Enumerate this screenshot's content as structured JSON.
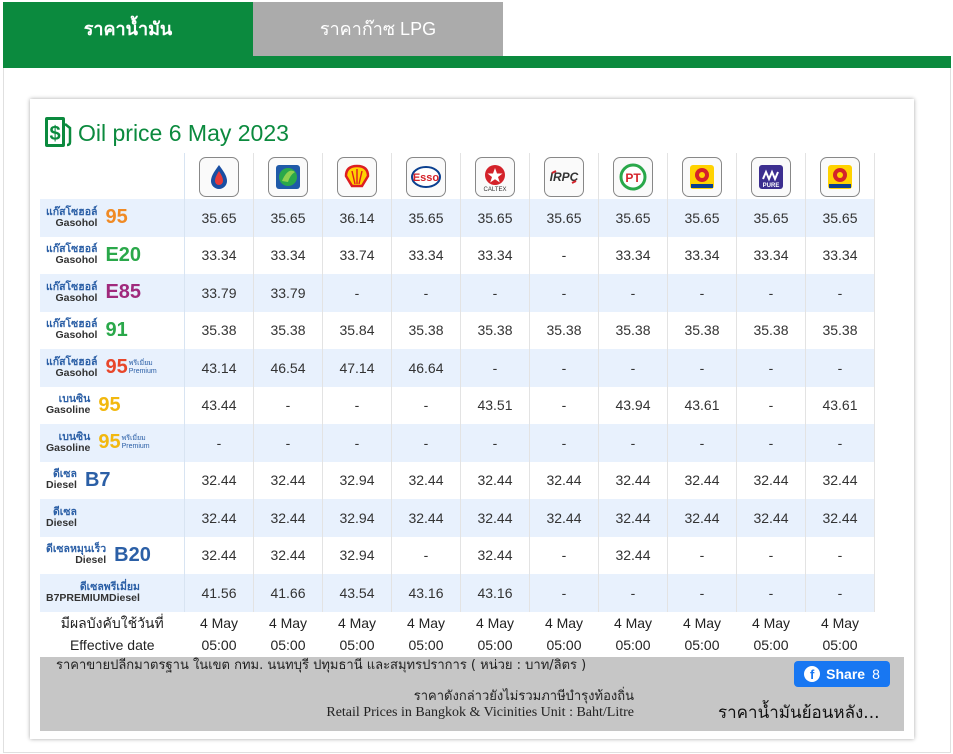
{
  "tabs": [
    {
      "label": "ราคาน้ำมัน",
      "active": true
    },
    {
      "label": "ราคาก๊าซ LPG",
      "active": false
    }
  ],
  "title": "Oil price 6 May 2023",
  "icons": {
    "title": "dollar-pump-icon"
  },
  "colors": {
    "brand_green": "#0b8a3e",
    "row_stripe": "#e8f1fd",
    "footer_bg": "#c6c6c6",
    "share_blue": "#1877f2"
  },
  "brands": [
    {
      "name": "PTT Station",
      "icon": "ptt-logo-icon"
    },
    {
      "name": "Bangchak",
      "icon": "bangchak-logo-icon"
    },
    {
      "name": "Shell",
      "icon": "shell-logo-icon"
    },
    {
      "name": "Esso",
      "icon": "esso-logo-icon"
    },
    {
      "name": "Caltex",
      "icon": "caltex-logo-icon"
    },
    {
      "name": "IRPC",
      "icon": "irpc-logo-icon"
    },
    {
      "name": "PT",
      "icon": "pt-logo-icon"
    },
    {
      "name": "Susco",
      "icon": "susco-logo-icon"
    },
    {
      "name": "Pure",
      "icon": "pure-logo-icon"
    },
    {
      "name": "Susco",
      "icon": "susco-logo-icon"
    }
  ],
  "rows": [
    {
      "th": "แก๊สโซฮอล์",
      "en": "Gasohol",
      "code": "95",
      "code_color": "#f08a24",
      "premium": "",
      "prices": [
        "35.65",
        "35.65",
        "36.14",
        "35.65",
        "35.65",
        "35.65",
        "35.65",
        "35.65",
        "35.65",
        "35.65"
      ]
    },
    {
      "th": "แก๊สโซฮอล์",
      "en": "Gasohol",
      "code": "E20",
      "code_color": "#2aa84a",
      "premium": "",
      "prices": [
        "33.34",
        "33.34",
        "33.74",
        "33.34",
        "33.34",
        "-",
        "33.34",
        "33.34",
        "33.34",
        "33.34"
      ]
    },
    {
      "th": "แก๊สโซฮอล์",
      "en": "Gasohol",
      "code": "E85",
      "code_color": "#a0297c",
      "premium": "",
      "prices": [
        "33.79",
        "33.79",
        "-",
        "-",
        "-",
        "-",
        "-",
        "-",
        "-",
        "-"
      ]
    },
    {
      "th": "แก๊สโซฮอล์",
      "en": "Gasohol",
      "code": "91",
      "code_color": "#2aa84a",
      "premium": "",
      "prices": [
        "35.38",
        "35.38",
        "35.84",
        "35.38",
        "35.38",
        "35.38",
        "35.38",
        "35.38",
        "35.38",
        "35.38"
      ]
    },
    {
      "th": "แก๊สโซฮอล์",
      "en": "Gasohol",
      "code": "95",
      "code_color": "#e8462a",
      "premium": "พรีเมี่ยม Premium",
      "prices": [
        "43.14",
        "46.54",
        "47.14",
        "46.64",
        "-",
        "-",
        "-",
        "-",
        "-",
        "-"
      ]
    },
    {
      "th": "เบนซิน",
      "en": "Gasoline",
      "code": "95",
      "code_color": "#f2b80f",
      "premium": "",
      "prices": [
        "43.44",
        "-",
        "-",
        "-",
        "43.51",
        "-",
        "43.94",
        "43.61",
        "-",
        "43.61"
      ]
    },
    {
      "th": "เบนซิน",
      "en": "Gasoline",
      "code": "95",
      "code_color": "#f2b80f",
      "premium": "พรีเมี่ยม Premium",
      "prices": [
        "-",
        "-",
        "-",
        "-",
        "-",
        "-",
        "-",
        "-",
        "-",
        "-"
      ]
    },
    {
      "th": "ดีเซล",
      "en": "Diesel",
      "code": "B7",
      "code_color": "#2b5fa6",
      "premium": "",
      "prices": [
        "32.44",
        "32.44",
        "32.94",
        "32.44",
        "32.44",
        "32.44",
        "32.44",
        "32.44",
        "32.44",
        "32.44"
      ]
    },
    {
      "th": "ดีเซล",
      "en": "Diesel",
      "code": "",
      "code_color": "#2b5fa6",
      "premium": "",
      "prices": [
        "32.44",
        "32.44",
        "32.94",
        "32.44",
        "32.44",
        "32.44",
        "32.44",
        "32.44",
        "32.44",
        "32.44"
      ]
    },
    {
      "th": "ดีเซลหมุนเร็ว",
      "en": "Diesel",
      "code": "B20",
      "code_color": "#2b5fa6",
      "premium": "",
      "prices": [
        "32.44",
        "32.44",
        "32.94",
        "-",
        "32.44",
        "-",
        "32.44",
        "-",
        "-",
        "-"
      ]
    },
    {
      "th": "ดีเซลพรีเมี่ยม",
      "en": "B7PREMIUMDiesel",
      "code": "",
      "code_color": "#2b5fa6",
      "premium": "",
      "prices": [
        "41.56",
        "41.66",
        "43.54",
        "43.16",
        "43.16",
        "-",
        "-",
        "-",
        "-",
        "-"
      ]
    }
  ],
  "effective": {
    "label_th": "มีผลบังคับใช้วันที่",
    "label_en": "Effective date",
    "dates": [
      "4 May",
      "4 May",
      "4 May",
      "4 May",
      "4 May",
      "4 May",
      "4 May",
      "4 May",
      "4 May",
      "4 May"
    ],
    "times": [
      "05:00",
      "05:00",
      "05:00",
      "05:00",
      "05:00",
      "05:00",
      "05:00",
      "05:00",
      "05:00",
      "05:00"
    ]
  },
  "footer": {
    "line1": "ราคาขายปลีกมาตรฐาน ในเขต กทม. นนทบุรี ปทุมธานี และสมุทรปราการ ( หน่วย : บาท/ลิตร )",
    "line2": "ราคาดังกล่าวยังไม่รวมภาษีบำรุงท้องถิ่น",
    "line3": "Retail Prices in Bangkok & Vicinities Unit : Baht/Litre",
    "share_label": "Share",
    "share_count": "8",
    "history_link": "ราคาน้ำมันย้อนหลัง..."
  }
}
